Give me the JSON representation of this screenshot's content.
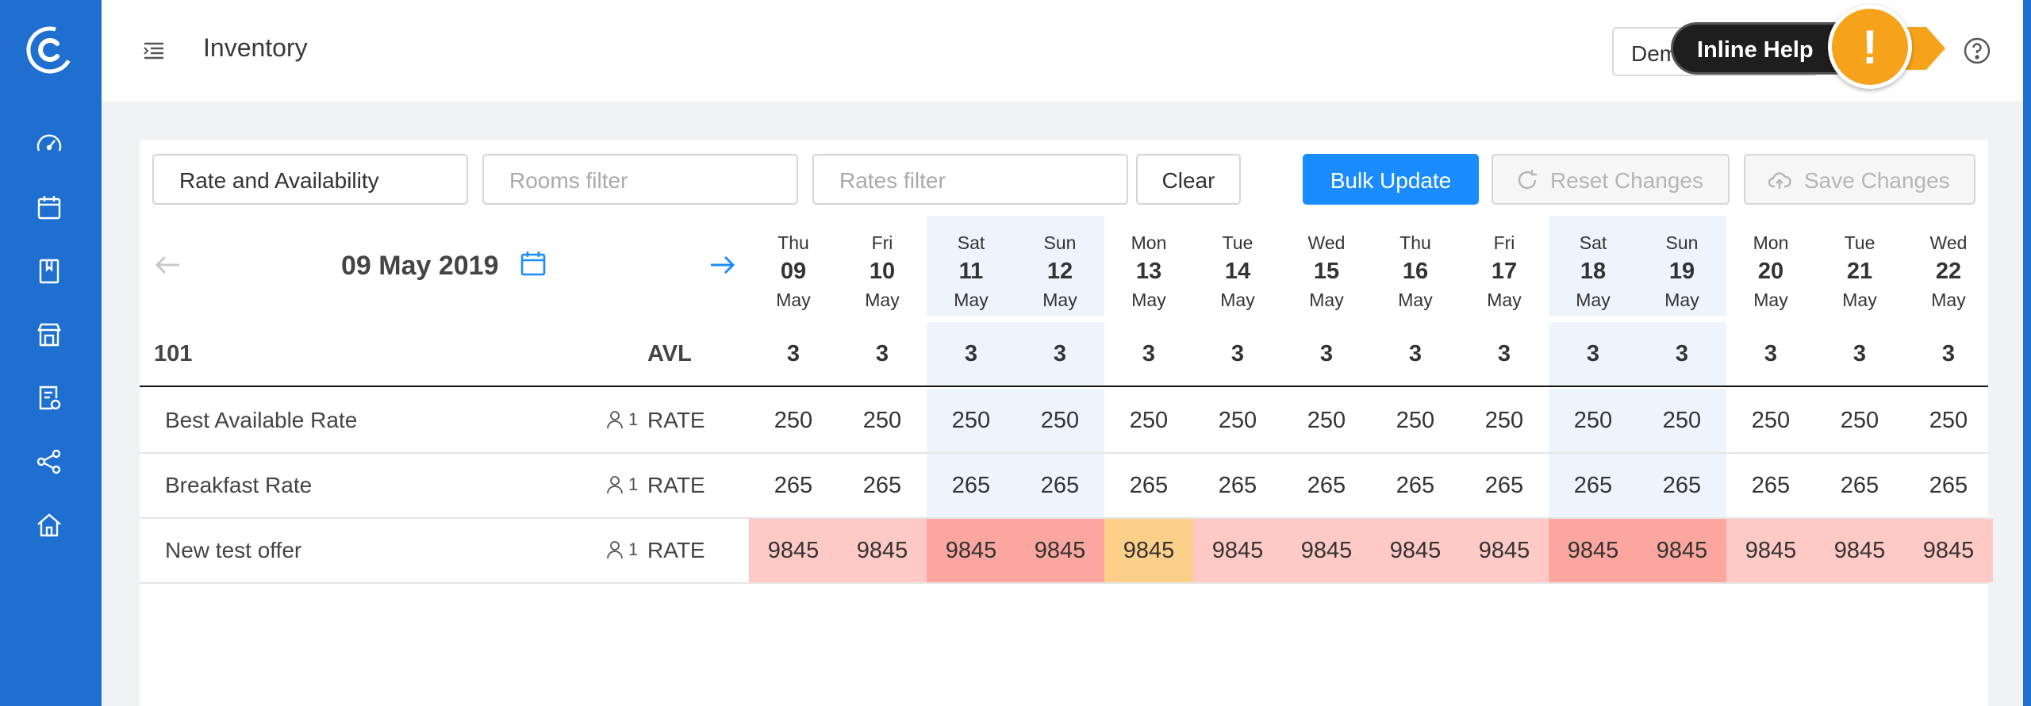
{
  "header": {
    "title": "Inventory",
    "account_button": "Demo",
    "inline_help_label": "Inline Help",
    "inline_help_symbol": "!"
  },
  "sidebar": {
    "icons": [
      "dashboard-icon",
      "calendar-icon",
      "bookmark-icon",
      "store-icon",
      "report-icon",
      "share-icon",
      "home-icon"
    ]
  },
  "toolbar": {
    "view_select": "Rate and Availability",
    "rooms_placeholder": "Rooms filter",
    "rates_placeholder": "Rates filter",
    "clear_label": "Clear",
    "bulk_update_label": "Bulk Update",
    "reset_label": "Reset Changes",
    "save_label": "Save Changes"
  },
  "calendar": {
    "current_date": "09 May 2019",
    "days": [
      {
        "dow": "Thu",
        "num": "09",
        "month": "May",
        "weekend": false
      },
      {
        "dow": "Fri",
        "num": "10",
        "month": "May",
        "weekend": false
      },
      {
        "dow": "Sat",
        "num": "11",
        "month": "May",
        "weekend": true
      },
      {
        "dow": "Sun",
        "num": "12",
        "month": "May",
        "weekend": true
      },
      {
        "dow": "Mon",
        "num": "13",
        "month": "May",
        "weekend": false
      },
      {
        "dow": "Tue",
        "num": "14",
        "month": "May",
        "weekend": false
      },
      {
        "dow": "Wed",
        "num": "15",
        "month": "May",
        "weekend": false
      },
      {
        "dow": "Thu",
        "num": "16",
        "month": "May",
        "weekend": false
      },
      {
        "dow": "Fri",
        "num": "17",
        "month": "May",
        "weekend": false
      },
      {
        "dow": "Sat",
        "num": "18",
        "month": "May",
        "weekend": true
      },
      {
        "dow": "Sun",
        "num": "19",
        "month": "May",
        "weekend": true
      },
      {
        "dow": "Mon",
        "num": "20",
        "month": "May",
        "weekend": false
      },
      {
        "dow": "Tue",
        "num": "21",
        "month": "May",
        "weekend": false
      },
      {
        "dow": "Wed",
        "num": "22",
        "month": "May",
        "weekend": false
      }
    ]
  },
  "room": {
    "name": "101",
    "avl_label": "AVL",
    "availability": [
      "3",
      "3",
      "3",
      "3",
      "3",
      "3",
      "3",
      "3",
      "3",
      "3",
      "3",
      "3",
      "3",
      "3"
    ]
  },
  "rates": [
    {
      "name": "Best Available Rate",
      "occupancy": "1",
      "label": "RATE",
      "values": [
        "250",
        "250",
        "250",
        "250",
        "250",
        "250",
        "250",
        "250",
        "250",
        "250",
        "250",
        "250",
        "250",
        "250"
      ],
      "colors": []
    },
    {
      "name": "Breakfast Rate",
      "occupancy": "1",
      "label": "RATE",
      "values": [
        "265",
        "265",
        "265",
        "265",
        "265",
        "265",
        "265",
        "265",
        "265",
        "265",
        "265",
        "265",
        "265",
        "265"
      ],
      "colors": []
    },
    {
      "name": "New test offer",
      "occupancy": "1",
      "label": "RATE",
      "values": [
        "9845",
        "9845",
        "9845",
        "9845",
        "9845",
        "9845",
        "9845",
        "9845",
        "9845",
        "9845",
        "9845",
        "9845",
        "9845",
        "9845"
      ],
      "colors": [
        "#ffc9c5",
        "#ffc9c5",
        "#fca6a0",
        "#fca6a0",
        "#fdd08a",
        "#ffc9c5",
        "#ffc9c5",
        "#ffc9c5",
        "#ffc9c5",
        "#fca6a0",
        "#fca6a0",
        "#ffc9c5",
        "#ffc9c5",
        "#ffc9c5"
      ]
    }
  ],
  "colors": {
    "sidebar": "#1f6fd1",
    "primary": "#1a8cff",
    "weekend_bg": "#eef4fc",
    "help_orange": "#f7a21b"
  }
}
